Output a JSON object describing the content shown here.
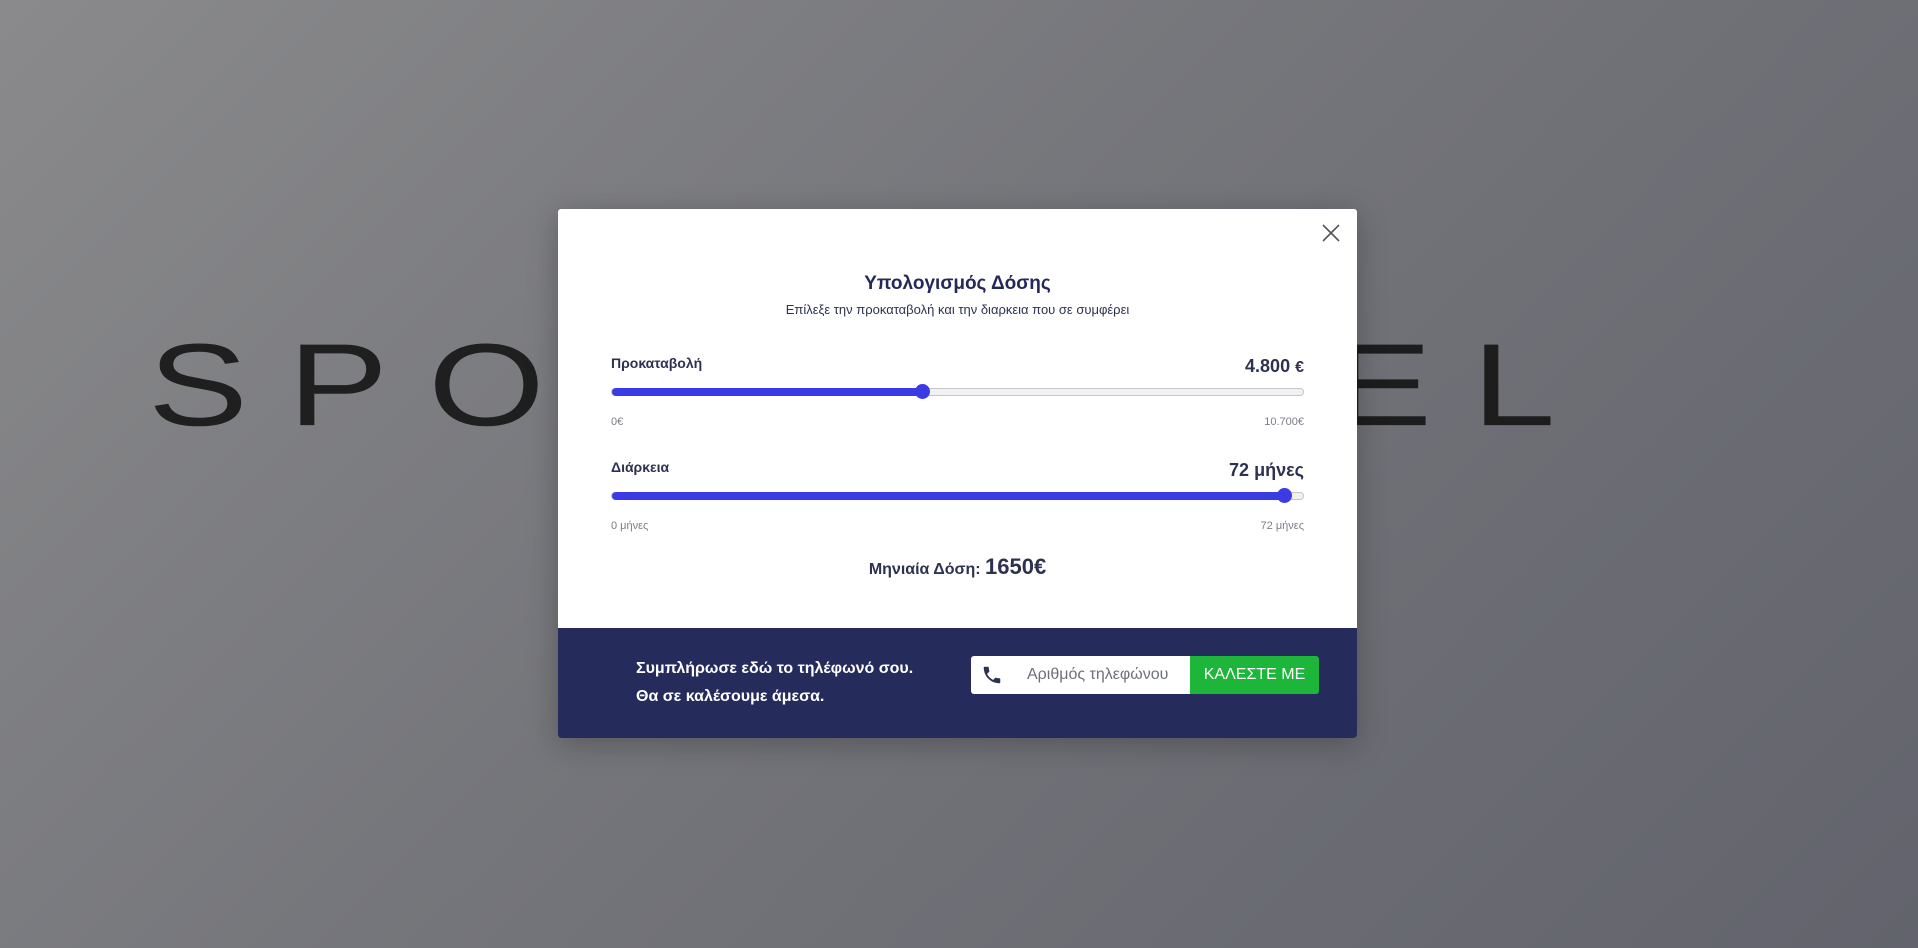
{
  "background": {
    "logo_text": "SPORTWHEEL"
  },
  "modal": {
    "title": "Υπολογισμός Δόσης",
    "subtitle": "Επίλεξε την προκαταβολή και την διαρκεια που σε συμφέρει",
    "down_payment": {
      "label": "Προκαταβολή",
      "value_text": "4.800",
      "unit": "€",
      "min_label": "0€",
      "max_label": "10.700€",
      "value": 4800,
      "min": 0,
      "max": 10700
    },
    "duration": {
      "label": "Διάρκεια",
      "value_text": "72 μήνες",
      "min_label": "0 μήνες",
      "max_label": "72 μήνες",
      "value": 72,
      "min": 0,
      "max": 72,
      "thumb_fraction": 0.973
    },
    "monthly": {
      "label": "Μηνιαία Δόση:",
      "amount": "1650€"
    }
  },
  "footer": {
    "line1": "Συμπλήρωσε εδώ το τηλέφωνό σου.",
    "line2": "Θα σε καλέσουμε άμεσα.",
    "phone_placeholder": "Αριθμός τηλεφώνου",
    "call_button": "ΚΑΛΕΣΤΕ ΜΕ"
  },
  "colors": {
    "accent": "#3b3be6",
    "footer_bg": "#252b5b",
    "call_button_bg": "#1db53a"
  }
}
